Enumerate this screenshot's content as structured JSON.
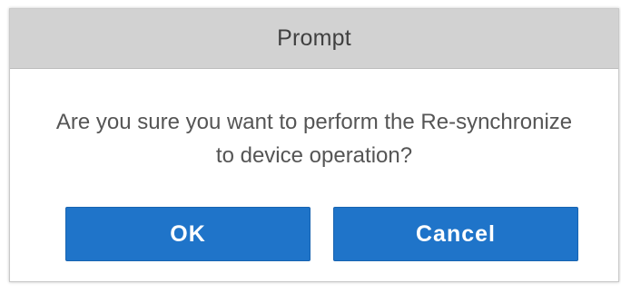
{
  "dialog": {
    "title": "Prompt",
    "message": "Are you sure you want to perform the Re-synchronize to device operation?",
    "ok_label": "OK",
    "cancel_label": "Cancel"
  },
  "colors": {
    "titlebar_bg": "#d2d2d2",
    "button_bg": "#1f74c9",
    "button_text": "#ffffff",
    "message_text": "#555555"
  }
}
